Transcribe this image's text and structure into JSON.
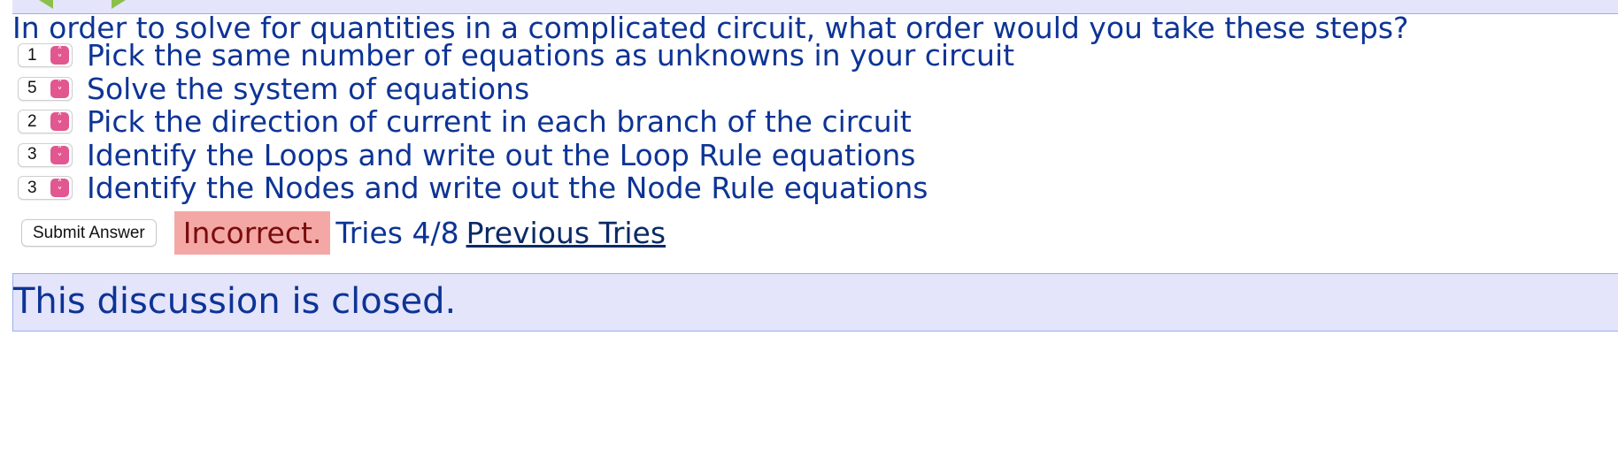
{
  "question": {
    "text": "In order to solve for quantities in a complicated circuit, what order would you take these steps?"
  },
  "steps": [
    {
      "selected": "1",
      "text": "Pick the same number of equations as unknowns in your circuit"
    },
    {
      "selected": "5",
      "text": "Solve the system of equations"
    },
    {
      "selected": "2",
      "text": "Pick the direction of current in each branch of the circuit"
    },
    {
      "selected": "3",
      "text": "Identify the Loops and write out the Loop Rule equations"
    },
    {
      "selected": "3",
      "text": "Identify the Nodes and write out the Node Rule equations"
    }
  ],
  "submission": {
    "button_label": "Submit Answer",
    "status": "Incorrect.",
    "tries": "Tries 4/8",
    "previous_tries_link": "Previous Tries"
  },
  "discussion": {
    "message": "This discussion is closed."
  },
  "colors": {
    "text_blue": "#0d3495",
    "panel_bg": "#e4e4fb",
    "incorrect_bg": "#f4a8a6",
    "select_accent": "#e2578f",
    "nav_arrow": "#8cc04a"
  },
  "icons": {
    "nav_previous": "arrow-left-icon",
    "nav_next": "arrow-right-icon",
    "select_stepper": "chevron-up-down-icon"
  }
}
